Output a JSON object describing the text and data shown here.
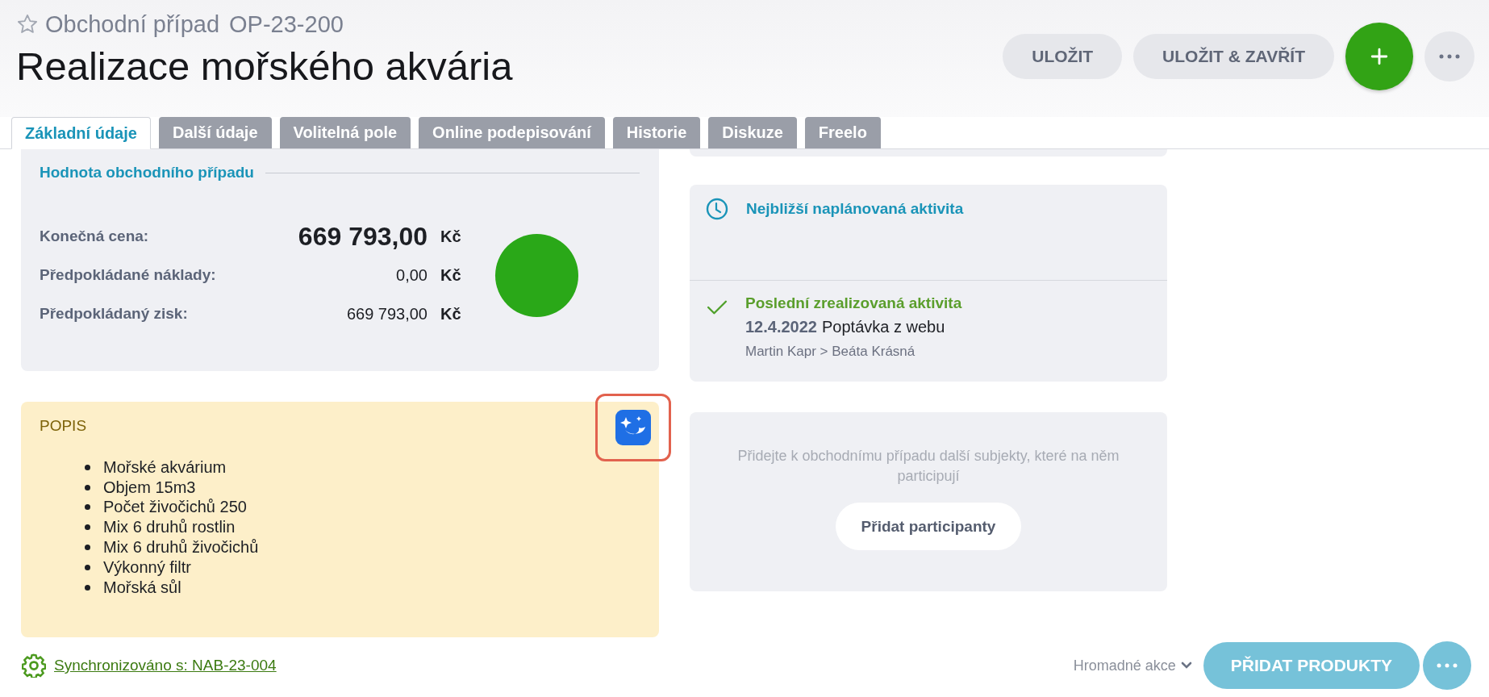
{
  "header": {
    "starred": false,
    "record_type": "Obchodní případ",
    "record_id": "OP-23-200",
    "title": "Realizace mořského akvária"
  },
  "actions": [
    {
      "kind": "pill",
      "label": "ULOŽIT"
    },
    {
      "kind": "pill",
      "label": "ULOŽIT & ZAVŘÍT"
    },
    {
      "kind": "add"
    },
    {
      "kind": "more"
    }
  ],
  "tabs": [
    {
      "label": "Základní údaje",
      "selected": true
    },
    {
      "label": "Další údaje",
      "selected": false
    },
    {
      "label": "Volitelná pole",
      "selected": false
    },
    {
      "label": "Online podepisování",
      "selected": false
    },
    {
      "label": "Historie",
      "selected": false
    },
    {
      "label": "Diskuze",
      "selected": false
    },
    {
      "label": "Freelo",
      "selected": false
    }
  ],
  "value_card": {
    "title": "Hodnota obchodního případu",
    "rows": [
      {
        "label": "Konečná cena:",
        "amount": "669 793,00",
        "currency": "Kč",
        "emphasis": true
      },
      {
        "label": "Předpokládané náklady:",
        "amount": "0,00",
        "currency": "Kč",
        "emphasis": false
      },
      {
        "label": "Předpokládaný zisk:",
        "amount": "669 793,00",
        "currency": "Kč",
        "emphasis": false
      }
    ],
    "status_dot": {
      "color": "#2aa818"
    }
  },
  "description": {
    "title": "POPIS",
    "highlighted": true,
    "items": [
      "Mořské akvárium",
      "Objem 15m3",
      "Počet živočichů 250",
      "Mix 6 druhů rostlin",
      "Mix 6 druhů živočichů",
      "Výkonný filtr",
      "Mořská sůl"
    ]
  },
  "activity": {
    "planned_title": "Nejbližší naplánovaná aktivita",
    "last_title": "Poslední zrealizovaná aktivita",
    "last_date": "12.4.2022",
    "last_name": "Poptávka z webu",
    "last_people": "Martin Kapr > Beáta Krásná"
  },
  "participants": {
    "message": "Přidejte k obchodnímu případu další subjekty, které na něm participují",
    "button": "Přidat participanty"
  },
  "footer": {
    "sync_link": "Synchronizováno s: NAB-23-004",
    "bulk_actions": "Hromadné akce",
    "add_products": "PŘIDAT PRODUKTY"
  }
}
